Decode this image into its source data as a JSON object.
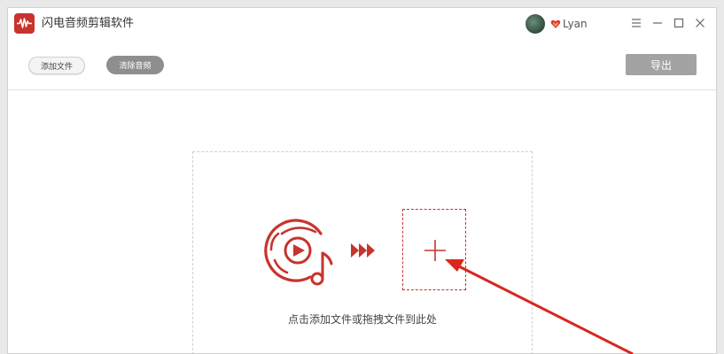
{
  "app": {
    "title": "闪电音频剪辑软件",
    "logo_icon": "waveform-logo-icon",
    "accent_color": "#c8332c"
  },
  "user": {
    "name": "Lyan",
    "avatar_icon": "user-avatar",
    "badge_icon": "vip-heart-icon"
  },
  "window_controls": {
    "menu_icon": "menu-icon",
    "minimize_icon": "minimize-icon",
    "maximize_icon": "maximize-icon",
    "close_icon": "close-icon"
  },
  "toolbar": {
    "add_file_label": "添加文件",
    "clear_audio_label": "清除音频",
    "export_label": "导出"
  },
  "dropzone": {
    "hint": "点击添加文件或拖拽文件到此处",
    "music_icon": "music-disc-icon",
    "arrows_icon": "triple-arrow-icon",
    "plus_icon": "plus-icon"
  }
}
